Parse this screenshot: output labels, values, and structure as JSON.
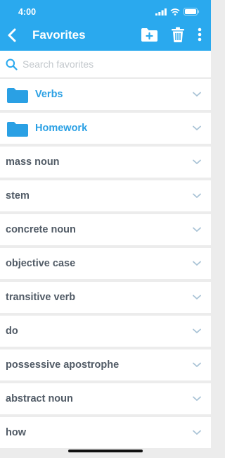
{
  "status": {
    "time": "4:00"
  },
  "nav": {
    "title": "Favorites"
  },
  "search": {
    "placeholder": "Search favorites"
  },
  "folders": [
    {
      "label": "Verbs"
    },
    {
      "label": "Homework"
    }
  ],
  "items": [
    {
      "label": "mass noun"
    },
    {
      "label": "stem"
    },
    {
      "label": "concrete noun"
    },
    {
      "label": "objective case"
    },
    {
      "label": "transitive verb"
    },
    {
      "label": "do"
    },
    {
      "label": "possessive apostrophe"
    },
    {
      "label": "abstract noun"
    },
    {
      "label": "how"
    }
  ],
  "colors": {
    "accent": "#2aa9ee",
    "folder": "#2aa0e4",
    "item_text": "#515b66",
    "chevron": "#a9c3d6"
  },
  "icons": [
    "back-icon",
    "new-folder-icon",
    "trash-icon",
    "more-vertical-icon",
    "search-icon",
    "folder-icon",
    "chevron-down-icon"
  ]
}
